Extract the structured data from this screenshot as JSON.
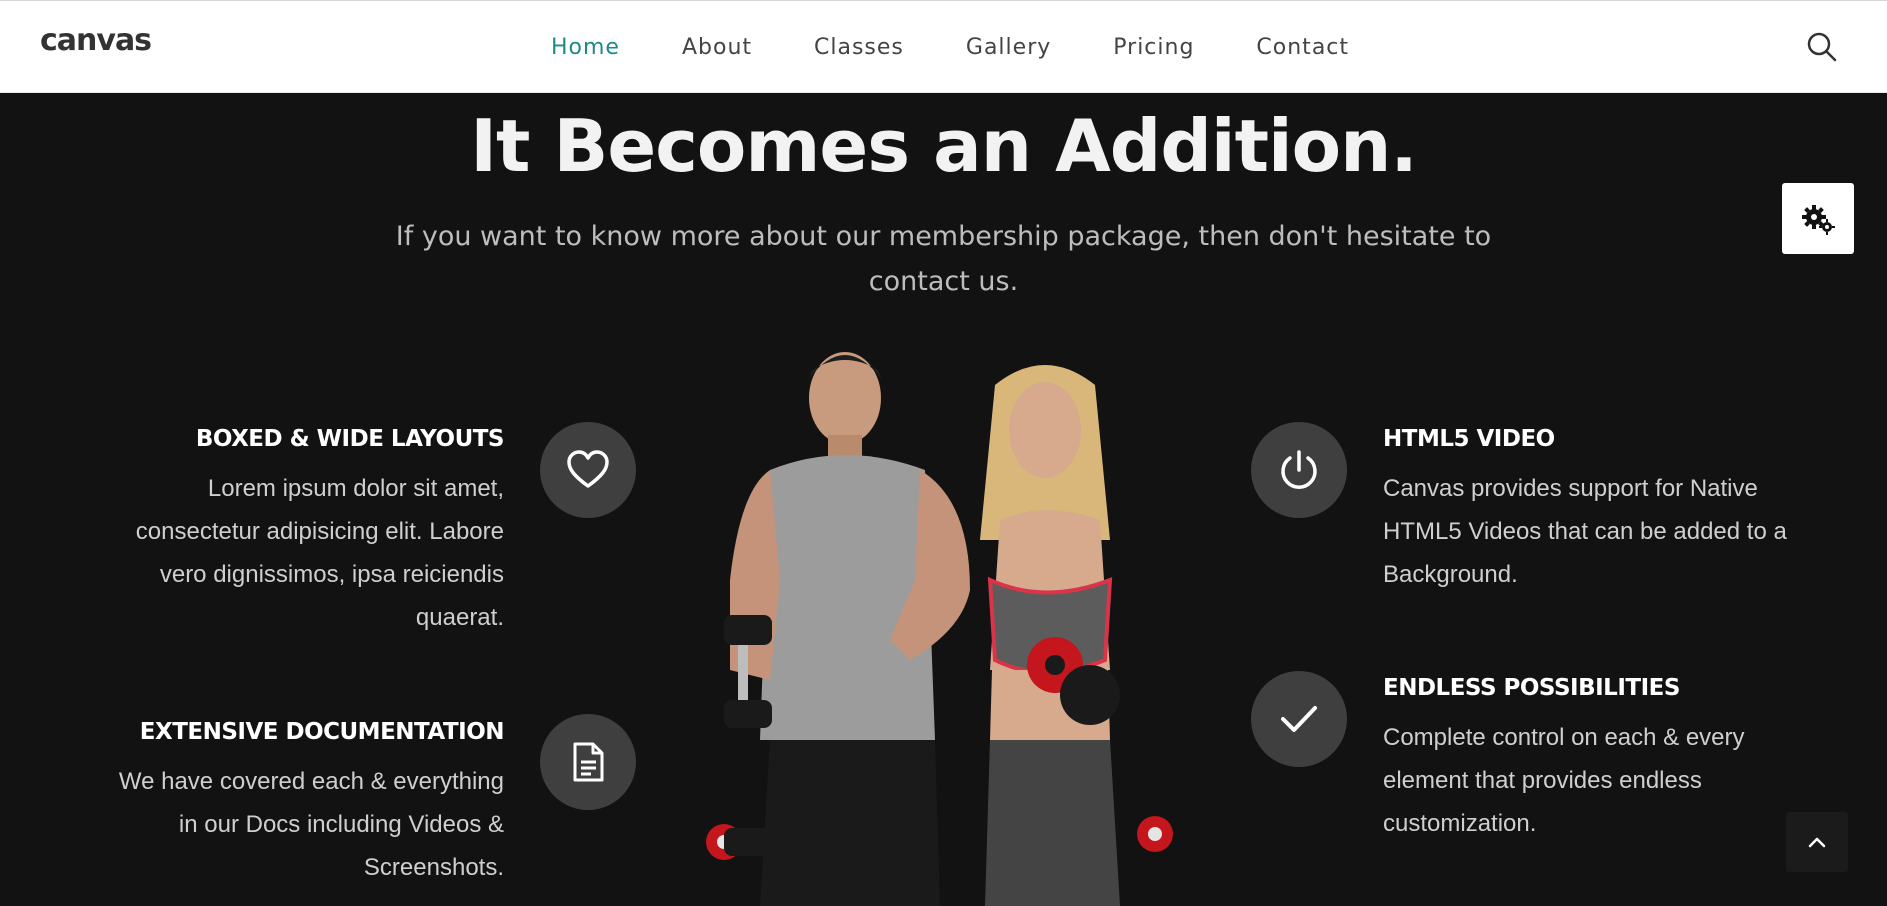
{
  "header": {
    "logo": "canvas",
    "nav": [
      "Home",
      "About",
      "Classes",
      "Gallery",
      "Pricing",
      "Contact"
    ],
    "active_nav": "Home",
    "accent_color": "#1f8a8a"
  },
  "hero": {
    "title": "It Becomes an Addition.",
    "subtitle_line1": "If you want to know more about our membership package, then don't hesitate to",
    "subtitle_line2": "contact us."
  },
  "features": {
    "boxed": {
      "title": "BOXED & WIDE LAYOUTS",
      "lines": [
        "Lorem ipsum dolor sit amet,",
        "consectetur adipisicing elit. Labore",
        "vero dignissimos, ipsa reiciendis",
        "quaerat."
      ],
      "icon": "heart-icon"
    },
    "docs": {
      "title": "EXTENSIVE DOCUMENTATION",
      "lines": [
        "We have covered each & everything",
        "in our Docs including Videos &",
        "Screenshots."
      ],
      "icon": "document-icon"
    },
    "video": {
      "title": "HTML5 VIDEO",
      "lines": [
        "Canvas provides support for Native",
        "HTML5 Videos that can be added to a",
        "Background."
      ],
      "icon": "power-icon"
    },
    "possibilities": {
      "title": "ENDLESS POSSIBILITIES",
      "lines": [
        "Complete control on each & every",
        "element that provides endless",
        "customization."
      ],
      "icon": "check-icon"
    }
  },
  "widgets": {
    "settings_icon": "gears-icon",
    "search_icon": "search-icon",
    "back_to_top_icon": "chevron-up-icon"
  }
}
